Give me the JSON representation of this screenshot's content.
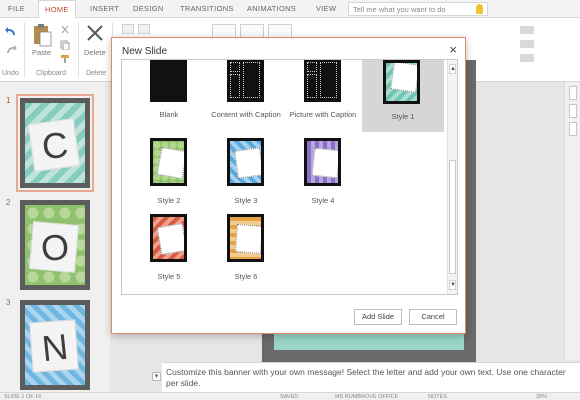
{
  "ribbon_tabs": [
    "FILE",
    "HOME",
    "INSERT",
    "DESIGN",
    "TRANSITIONS",
    "ANIMATIONS",
    "VIEW"
  ],
  "active_tab": "HOME",
  "search": {
    "placeholder": "Tell me what you want to do"
  },
  "ribbon": {
    "undo_group_label": "Undo",
    "clipboard_group_label": "Clipboard",
    "paste_label": "Paste",
    "delete_label": "Delete",
    "delete_group_label": "Delete"
  },
  "thumbnails": [
    {
      "number": "1",
      "letter": "C",
      "selected": true,
      "pattern": "teal"
    },
    {
      "number": "2",
      "letter": "O",
      "selected": false,
      "pattern": "green"
    },
    {
      "number": "3",
      "letter": "N",
      "selected": false,
      "pattern": "blue"
    }
  ],
  "notes": {
    "text": "Customize this banner with your own message! Select the letter and add your own text. Use one character per slide."
  },
  "statusbar": {
    "slide_info": "SLIDE 1 OF 16",
    "saved": "SAVED",
    "office": "MS RUMBROVE OFFICE",
    "notes": "NOTES",
    "zoom": "39%"
  },
  "dialog": {
    "title": "New Slide",
    "close_glyph": "×",
    "layouts": [
      {
        "name": "Blank",
        "kind": "blank"
      },
      {
        "name": "Content with Caption",
        "kind": "content"
      },
      {
        "name": "Picture with Caption",
        "kind": "picture"
      },
      {
        "name": "Style 1",
        "kind": "style",
        "color": "#6cc5b0",
        "selected": true
      },
      {
        "name": "Style 2",
        "kind": "style",
        "color": "#8ac16a"
      },
      {
        "name": "Style 3",
        "kind": "style",
        "color": "#5aa9dd"
      },
      {
        "name": "Style 4",
        "kind": "style",
        "color": "#8a70c7"
      },
      {
        "name": "Style 5",
        "kind": "style",
        "color": "#d75a3f"
      },
      {
        "name": "Style 6",
        "kind": "style",
        "color": "#e7a343"
      }
    ],
    "add_button": "Add Slide",
    "cancel_button": "Cancel"
  },
  "colors": {
    "accent": "#c4462b",
    "dialog_border": "#e08a6c"
  }
}
